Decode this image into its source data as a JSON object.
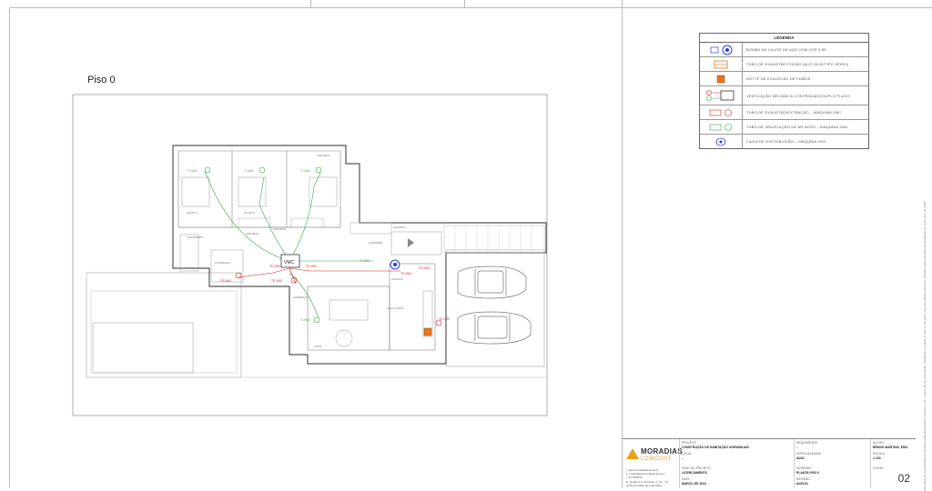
{
  "plan": {
    "title": "Piso 0",
    "room_labels": [
      "ESCRITÓRIO",
      "ARRUMOS",
      "ARRUMOS",
      "ARRUMOS",
      "CORREDOR",
      "LAVANDARIA",
      "ENTRADA",
      "ALPENDRE",
      "SALA COMUM",
      "COZINHA",
      "QUARTO",
      "QUARTO",
      "SUITE"
    ],
    "duct_labels": [
      "TI-VMC",
      "TI-VMC",
      "TI-VMC",
      "TE-VMC",
      "TE-VMC",
      "TE-VMC",
      "TE-VMC",
      "TI-VMC",
      "TI-VMC",
      "TE-VMC",
      "TE-VMC",
      "TE-VMC"
    ],
    "vmc_label": "VMC"
  },
  "legend": {
    "title": "LEGENDA",
    "items": [
      {
        "icon": "heat-pump-icon",
        "text": "BOMBA DE CALOR DE AQS COM COP 3,5K"
      },
      {
        "icon": "exhaust-flue-icon",
        "text": "TUBO DE EXAUSTÃO FOGÃO (AÇO INOX/TIPO SPIRO)"
      },
      {
        "icon": "smoke-hood-icon",
        "text": "HOTTE DE EXAUSTÃO DE FUMOS"
      },
      {
        "icon": "vmc-unit-icon",
        "text": "VENTILAÇÃO MECÂNICA CONTROLADA DUPLO FLUXO"
      },
      {
        "icon": "extraction-duct-icon",
        "text": "TUBO DE EXAUSTÃO/EXTRAÇÃO – MÁQUINA VMC"
      },
      {
        "icon": "insufflation-duct-icon",
        "text": "TUBO DE INSUFLAÇÃO DE AR NOVO – MÁQUINA VMC"
      },
      {
        "icon": "distribution-box-icon",
        "text": "CAIXA DE DISTRIBUIÇÃO – MÁQUINA VMC"
      }
    ]
  },
  "colors": {
    "supply": "#3fa34d",
    "extract": "#d62020",
    "heat_pump": "#2b3fd6",
    "hood": "#e8731e"
  },
  "title_block": {
    "projeto_label": "PROJETO",
    "projeto_value": "CONSTRUÇÃO DE HABITAÇÃO UNIFAMILIAR",
    "requerente_label": "REQUERENTE",
    "requerente_value": "–",
    "autor_label": "AUTOR",
    "autor_value": "BRUNO MARTINS, ENG.",
    "local_label": "LOCAL",
    "local_value": "–",
    "especialidade_label": "ESPECIALIDADE",
    "especialidade_value": "AVAC",
    "escala_label": "ESCALA",
    "escala_value": "1:100",
    "fase_label": "FASE DO PROJETO",
    "fase_value": "LICENCIAMENTO",
    "desenho_label": "DESENHO",
    "desenho_value": "PLANTA PISO 0",
    "folha_label": "FOLHA",
    "data_label": "DATA",
    "data_value": "MARÇO DE 2024",
    "revisao_label": "REVISÃO",
    "revisao_value": "AVAC01",
    "sheet_number": "02",
    "logo_name": "MORADIAS",
    "logo_sub": "LOWCOST",
    "contacts": [
      "t. www.moradiaslowcost.pt",
      "e. moradiaslowcost@gmail.com",
      "t. 917156533",
      "R. Quadros G, Parcela, n.º 61 - LX",
      "4470-470 Maia do Calendário"
    ]
  },
  "side_note": "Este desenho é propriedade da empresa Soluções-Estudos e Projetos, Lda. e não pode ser reproduzido, divulgado ou cedido no todo ou em parte, sem autorização expressa. Infrações serão tratadas pela legislação em vigor. Dec.-lei 63/85"
}
